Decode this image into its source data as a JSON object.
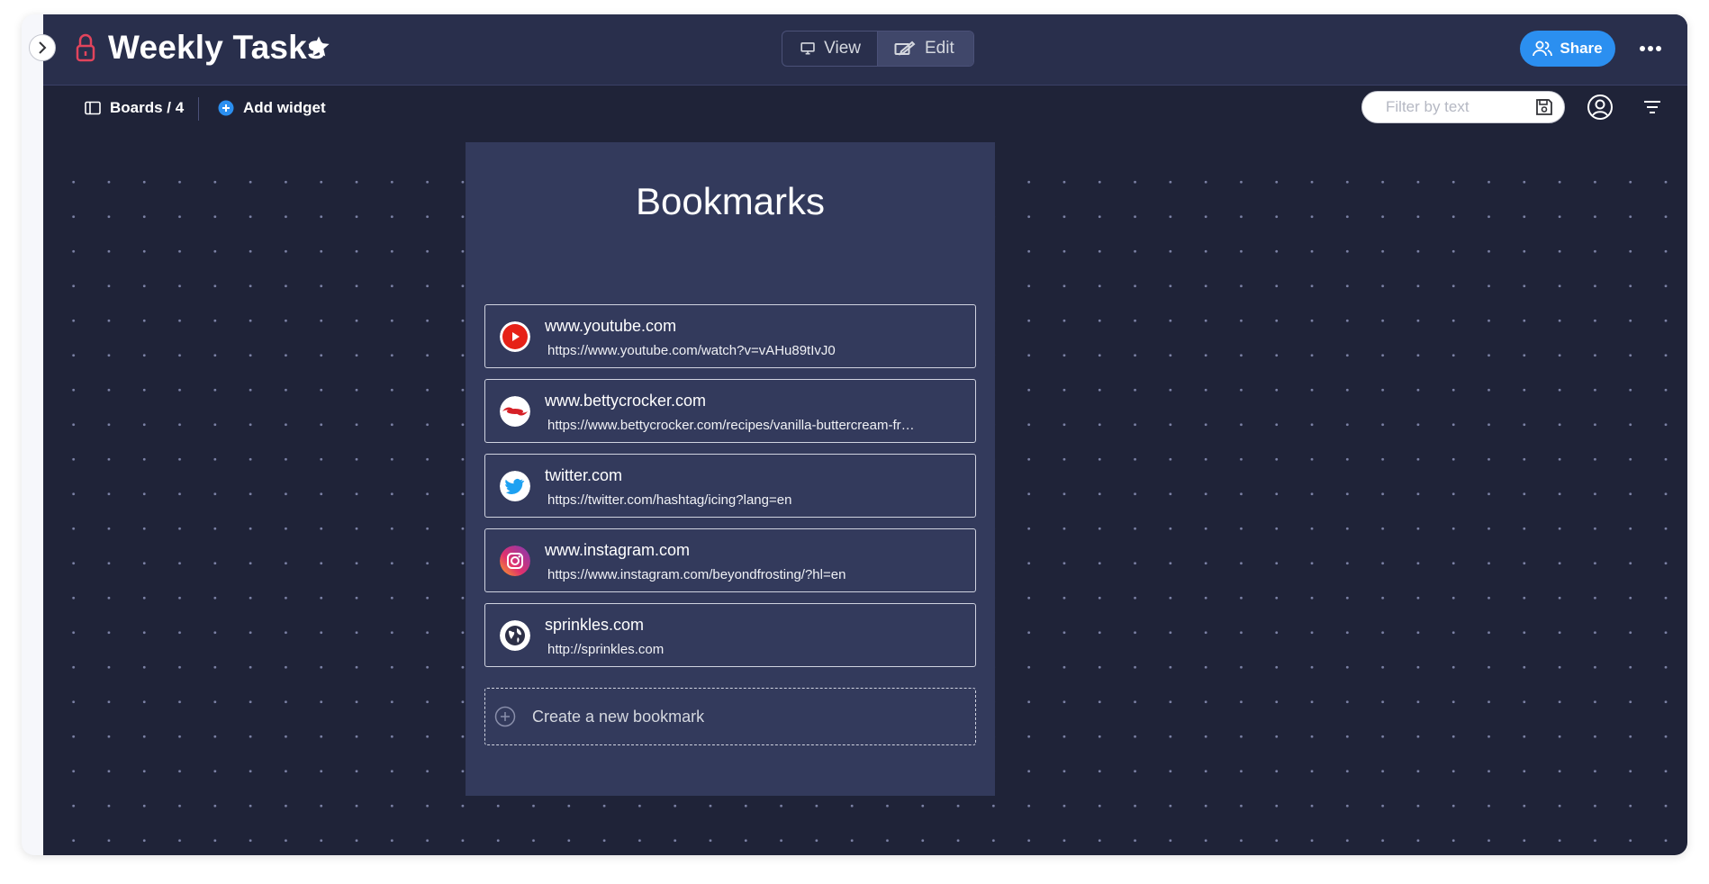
{
  "header": {
    "title": "Weekly Tasks",
    "view_label": "View",
    "edit_label": "Edit",
    "share_label": "Share"
  },
  "toolbar": {
    "boards_label": "Boards / 4",
    "add_widget_label": "Add widget",
    "filter_placeholder": "Filter by text"
  },
  "widget": {
    "title": "Bookmarks",
    "bookmarks": [
      {
        "title": "www.youtube.com",
        "url": "https://www.youtube.com/watch?v=vAHu89tIvJ0",
        "icon": "youtube-icon"
      },
      {
        "title": "www.bettycrocker.com",
        "url": "https://www.bettycrocker.com/recipes/vanilla-buttercream-frosting/",
        "icon": "bettycrocker-icon"
      },
      {
        "title": "twitter.com",
        "url": "https://twitter.com/hashtag/icing?lang=en",
        "icon": "twitter-icon"
      },
      {
        "title": "www.instagram.com",
        "url": "https://www.instagram.com/beyondfrosting/?hl=en",
        "icon": "instagram-icon"
      },
      {
        "title": "sprinkles.com",
        "url": "http://sprinkles.com",
        "icon": "globe-icon"
      }
    ],
    "create_label": "Create a new bookmark"
  },
  "colors": {
    "background": "#1f2338",
    "header": "#292f4c",
    "widget": "#333a5c",
    "accent": "#2b8ff0",
    "lock": "#e2445c"
  }
}
